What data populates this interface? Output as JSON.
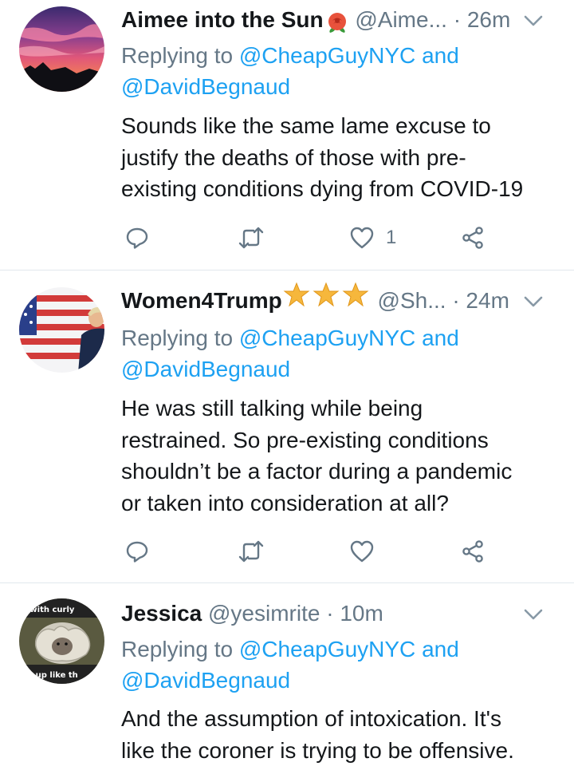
{
  "tweets": [
    {
      "name": "Aimee into the Sun",
      "handle": "@Aime...",
      "time": "26m",
      "reply_prefix": "Replying to",
      "reply_user1": "@CheapGuyNYC",
      "reply_and": "and",
      "reply_user2": "@DavidBegnaud",
      "body": [
        "Sounds like the same lame excuse to",
        "justify the deaths of those with pre-",
        "existing conditions dying from COVID-19"
      ],
      "like_count": "1",
      "name_emoji": "rose-icon"
    },
    {
      "name": "Women4Trump",
      "handle": "@Sh...",
      "time": "24m",
      "reply_prefix": "Replying to",
      "reply_user1": "@CheapGuyNYC",
      "reply_and": "and",
      "reply_user2": "@DavidBegnaud",
      "body": [
        "He was still talking while being",
        "restrained. So pre-existing conditions",
        "shouldn’t be a factor during a pandemic",
        "or taken into consideration at all?"
      ],
      "like_count": "",
      "name_emoji": "star-icon"
    },
    {
      "name": "Jessica",
      "handle": "@yesimrite",
      "time": "10m",
      "reply_prefix": "Replying to",
      "reply_user1": "@CheapGuyNYC",
      "reply_and": "and",
      "reply_user2": "@DavidBegnaud",
      "body": [
        "And the assumption of intoxication. It's",
        "like the coroner is trying to be offensive."
      ],
      "avatar_text_top": "s with curly",
      "avatar_text_bottom": "ke up like th"
    }
  ],
  "separator": "·",
  "colors": {
    "link": "#1da1f2",
    "muted": "#657786",
    "text": "#14171a",
    "divider": "#e1e8ed"
  }
}
